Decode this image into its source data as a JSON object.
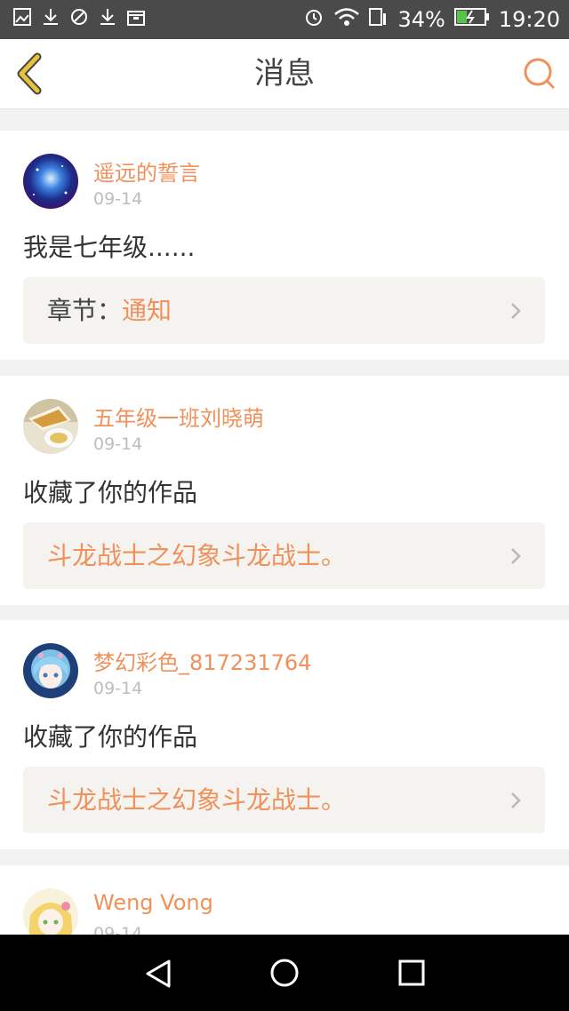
{
  "status_bar": {
    "battery": "34%",
    "time": "19:20"
  },
  "header": {
    "title": "消息"
  },
  "messages": [
    {
      "user": "遥远的誓言",
      "date": "09-14",
      "text": "我是七年级......",
      "ref_label": "章节：",
      "ref_value": "通知"
    },
    {
      "user": "五年级一班刘晓萌",
      "date": "09-14",
      "text": "收藏了你的作品",
      "ref_label": "",
      "ref_value": "斗龙战士之幻象斗龙战士。"
    },
    {
      "user": "梦幻彩色_817231764",
      "date": "09-14",
      "text": "收藏了你的作品",
      "ref_label": "",
      "ref_value": "斗龙战士之幻象斗龙战士。"
    },
    {
      "user": "Weng Vong",
      "date": "09-14"
    }
  ],
  "colors": {
    "accent": "#f0905a",
    "back_icon": "#e8c23a",
    "page_bg": "#f2f2f2"
  }
}
